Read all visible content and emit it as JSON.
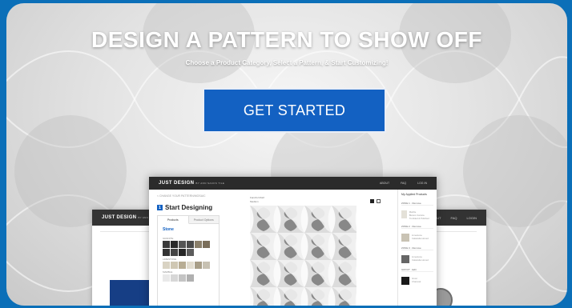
{
  "hero": {
    "title": "DESIGN A PATTERN TO SHOW OFF",
    "subtitle": "Choose a Product Category, Select a Pattern, & Start Customizing!",
    "cta_label": "GET STARTED"
  },
  "colors": {
    "accent": "#1361c2",
    "page_border": "#0b6fb8",
    "header_bar": "#2b2b2b"
  },
  "back_window": {
    "brand": "JUST DESIGN",
    "brand_small": "BY ANN",
    "nav": [
      "ABOUT",
      "FAQ",
      "LOGIN"
    ]
  },
  "front_window": {
    "brand": "JUST DESIGN",
    "brand_small": "BY ANN SACKS TILE",
    "nav": [
      "ABOUT",
      "FAQ",
      "LOG IN"
    ],
    "breadcrumb": "< CHANGE YOUR PATTERN/MOSAIC",
    "heading": "Start Designing",
    "step_number": "1",
    "tabs": [
      "Products",
      "Product Options"
    ],
    "section": "Stone",
    "categories": [
      "GRANITE",
      "LIMESTONE",
      "MARBLE"
    ],
    "canvas_label_1": "Fanciful Motif",
    "canvas_label_2": "Medium",
    "sidebar_title": "My Applied Products",
    "zones": [
      {
        "label": "ZONE 1",
        "status": "Remove",
        "name": "Marble",
        "desc": "Bianco Carrara Tumbled & Polished"
      },
      {
        "label": "ZONE 2",
        "status": "Remove",
        "name": "Limestone",
        "desc": "Calacatta Honed"
      },
      {
        "label": "ZONE 3",
        "status": "Remove",
        "name": "Limestone",
        "desc": "Calacatta Honed"
      },
      {
        "label": "GROUT",
        "status": "Edit",
        "name": "Grout",
        "desc": "Charcoal"
      }
    ]
  }
}
